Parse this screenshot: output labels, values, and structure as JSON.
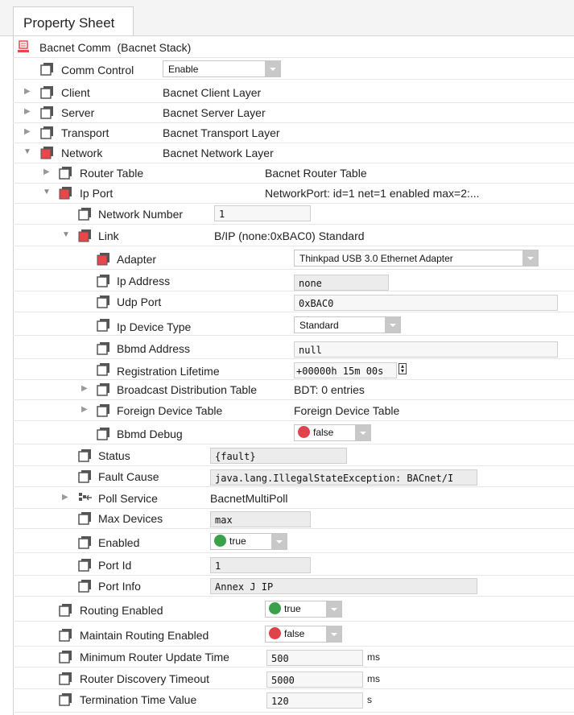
{
  "tab_title": "Property Sheet",
  "root": {
    "label": "Bacnet Comm",
    "type": "(Bacnet Stack)"
  },
  "rows": {
    "comm_control": {
      "label": "Comm Control",
      "value": "Enable"
    },
    "client": {
      "label": "Client",
      "value": "Bacnet Client Layer"
    },
    "server": {
      "label": "Server",
      "value": "Bacnet Server Layer"
    },
    "transport": {
      "label": "Transport",
      "value": "Bacnet Transport Layer"
    },
    "network": {
      "label": "Network",
      "value": "Bacnet Network Layer"
    },
    "router_table": {
      "label": "Router Table",
      "value": "Bacnet Router Table"
    },
    "ip_port": {
      "label": "Ip Port",
      "value": "NetworkPort: id=1 net=1 enabled max=2:..."
    },
    "network_number": {
      "label": "Network Number",
      "value": "1"
    },
    "link": {
      "label": "Link",
      "value": "B/IP (none:0xBAC0) Standard"
    },
    "adapter": {
      "label": "Adapter",
      "value": "Thinkpad USB 3.0 Ethernet Adapter"
    },
    "ip_address": {
      "label": "Ip Address",
      "value": "none"
    },
    "udp_port": {
      "label": "Udp Port",
      "value": "0xBAC0"
    },
    "ip_device_type": {
      "label": "Ip Device Type",
      "value": "Standard"
    },
    "bbmd_address": {
      "label": "Bbmd Address",
      "value": "null"
    },
    "registration_lifetime": {
      "label": "Registration Lifetime",
      "value": "+00000h 15m 00s"
    },
    "bdt": {
      "label": "Broadcast Distribution Table",
      "value": "BDT: 0 entries"
    },
    "fdt": {
      "label": "Foreign Device Table",
      "value": "Foreign Device Table"
    },
    "bbmd_debug": {
      "label": "Bbmd Debug",
      "value": "false"
    },
    "status": {
      "label": "Status",
      "value": "{fault}"
    },
    "fault_cause": {
      "label": "Fault Cause",
      "value": "java.lang.IllegalStateException: BACnet/I"
    },
    "poll_service": {
      "label": "Poll Service",
      "value": "BacnetMultiPoll"
    },
    "max_devices": {
      "label": "Max Devices",
      "value": "max"
    },
    "enabled": {
      "label": "Enabled",
      "value": "true"
    },
    "port_id": {
      "label": "Port Id",
      "value": "1"
    },
    "port_info": {
      "label": "Port Info",
      "value": "Annex J IP"
    },
    "routing_enabled": {
      "label": "Routing Enabled",
      "value": "true"
    },
    "maintain_routing_enabled": {
      "label": "Maintain Routing Enabled",
      "value": "false"
    },
    "min_router_update_time": {
      "label": "Minimum Router Update Time",
      "value": "500",
      "unit": "ms"
    },
    "router_discovery_timeout": {
      "label": "Router Discovery Timeout",
      "value": "5000",
      "unit": "ms"
    },
    "termination_time_value": {
      "label": "Termination Time Value",
      "value": "120",
      "unit": "s"
    }
  },
  "colors": {
    "true_dot": "#3aa14a",
    "false_dot": "#e0434a",
    "icon_red": "#e8474a",
    "icon_dark": "#555555"
  }
}
